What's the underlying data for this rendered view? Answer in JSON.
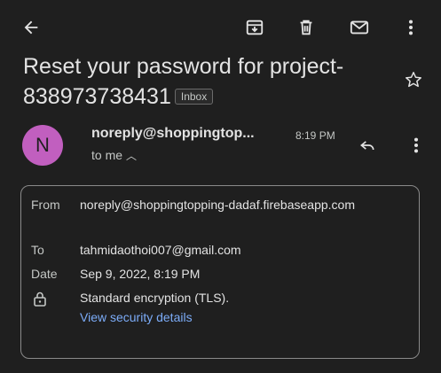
{
  "toolbar": {
    "back_icon": "arrow-left-icon",
    "archive_icon": "archive-icon",
    "delete_icon": "trash-icon",
    "mark_unread_icon": "envelope-icon",
    "more_icon": "more-vert-icon"
  },
  "email": {
    "subject": "Reset your password for project-838973738431",
    "label": "Inbox",
    "sender_initial": "N",
    "sender": "noreply@shoppingtop...",
    "time": "8:19 PM",
    "to_me": "to me",
    "avatar_color": "#c15fbf"
  },
  "details": {
    "from_label": "From",
    "from_value": "noreply@shoppingtopping-dadaf.firebaseapp.com",
    "to_label": "To",
    "to_value": "tahmidaothoi007@gmail.com",
    "date_label": "Date",
    "date_value": "Sep 9, 2022, 8:19 PM",
    "security_value": "Standard encryption (TLS).",
    "security_link": "View security details"
  },
  "colors": {
    "background": "#1f1f1f",
    "text": "#e3e3e3",
    "link": "#7cacf8"
  }
}
